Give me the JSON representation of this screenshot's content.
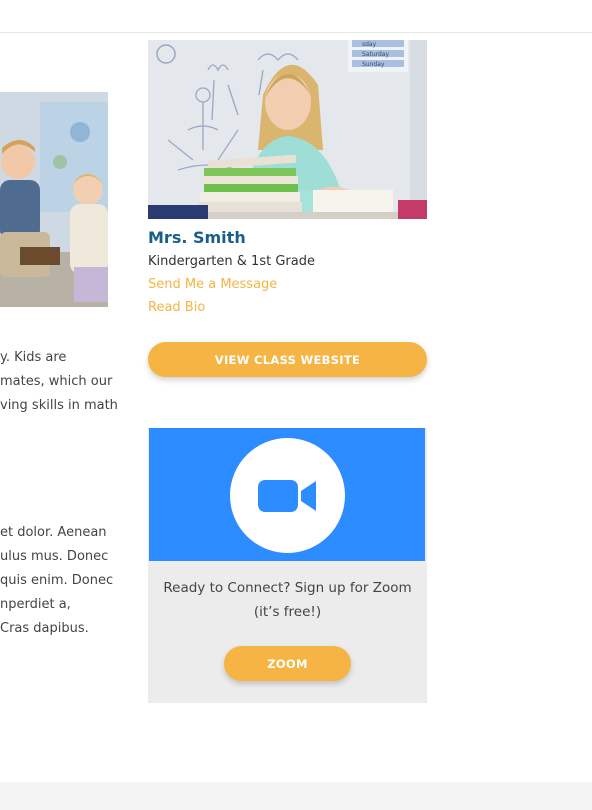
{
  "left": {
    "paragraph1": [
      "y. Kids are",
      "mates, which our",
      "ving skills in math"
    ],
    "paragraph2": [
      "et dolor. Aenean",
      "ulus mus. Donec",
      "quis enim. Donec",
      "nperdiet a,",
      "Cras dapibus."
    ]
  },
  "teacher": {
    "name": "Mrs. Smith",
    "grade": "Kindergarten & 1st Grade",
    "message_link": "Send Me a Message",
    "bio_link": "Read Bio",
    "class_button": "VIEW CLASS WEBSITE",
    "board_days": [
      "sday",
      "Saturday",
      "Sunday"
    ]
  },
  "zoom": {
    "text_line1": "Ready to Connect? Sign up for Zoom",
    "text_line2": "(it’s free!)",
    "button": "ZOOM",
    "icon": "video-camera-icon"
  },
  "colors": {
    "accent": "#f5b443",
    "name_blue": "#1a5e8a",
    "zoom_blue": "#2d8cff"
  }
}
